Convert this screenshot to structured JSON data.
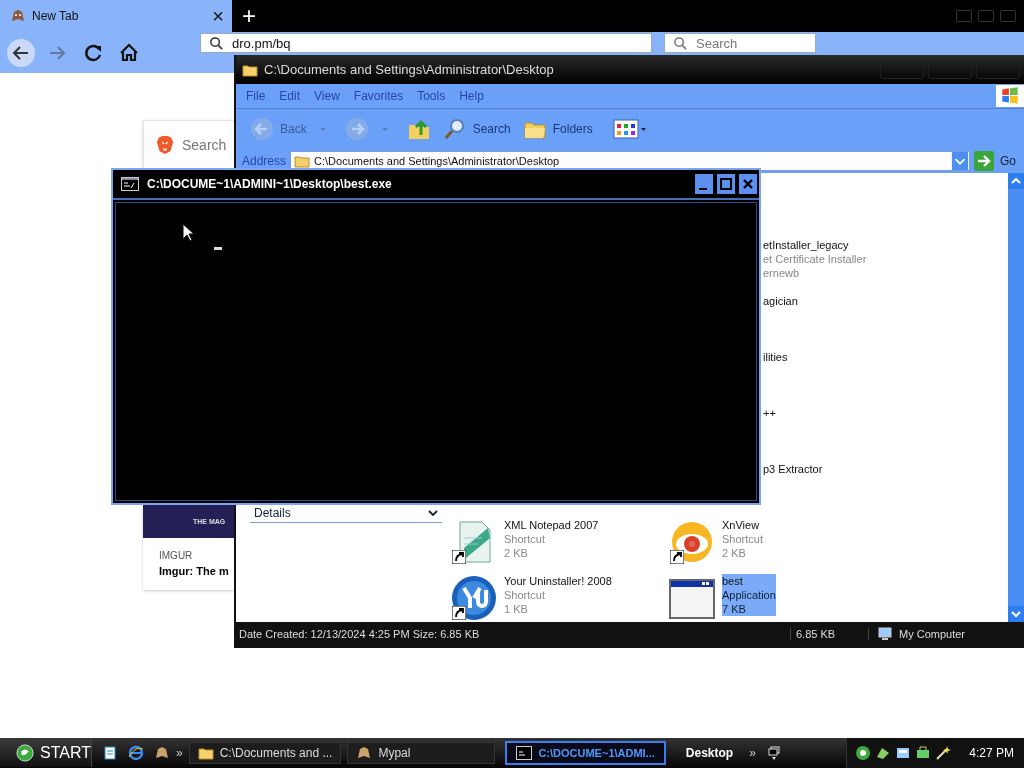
{
  "browser": {
    "tab": {
      "title": "New Tab",
      "close": "×",
      "selected": true
    },
    "new_tab": "+",
    "forward_disabled": true,
    "url": "dro.pm/bq",
    "search_placeholder": "Search",
    "page": {
      "search_card": {
        "placeholder": "Search"
      },
      "story": {
        "image_text": "THE MAG",
        "source": "IMGUR",
        "title": "Imgur: The m"
      }
    }
  },
  "explorer": {
    "title": "C:\\Documents and Settings\\Administrator\\Desktop",
    "menu": [
      "File",
      "Edit",
      "View",
      "Favorites",
      "Tools",
      "Help"
    ],
    "toolbar": [
      {
        "kind": "back",
        "label": "Back",
        "disabled": true
      },
      {
        "kind": "forward",
        "disabled": true
      },
      {
        "kind": "up",
        "disabled": false
      },
      {
        "kind": "search",
        "label": "Search",
        "disabled": false
      },
      {
        "kind": "folders",
        "label": "Folders",
        "disabled": false
      },
      {
        "kind": "views",
        "disabled": false
      }
    ],
    "address_label": "Address",
    "address": "C:\\Documents and Settings\\Administrator\\Desktop",
    "go": "Go",
    "details": "Details",
    "fragments": [
      {
        "lines": [
          "etInstaller_legacy",
          "et Certificate Installer",
          "ernewb"
        ]
      },
      {
        "lines": [
          "agician"
        ]
      },
      {
        "lines": [
          "ilities"
        ]
      },
      {
        "lines": [
          "++"
        ]
      },
      {
        "lines": [
          "p3 Extractor"
        ]
      }
    ],
    "files": [
      {
        "name": "XML Notepad 2007",
        "type": "Shortcut",
        "size": "2 KB",
        "kind": "xml",
        "shortcut": true,
        "selected": false
      },
      {
        "name": "XnView",
        "type": "Shortcut",
        "size": "2 KB",
        "kind": "eye",
        "shortcut": true,
        "selected": false
      },
      {
        "name": "Your Uninstaller! 2008",
        "type": "Shortcut",
        "size": "1 KB",
        "kind": "uninstaller",
        "shortcut": true,
        "selected": false
      },
      {
        "name": "best",
        "type": "Application",
        "size": "7 KB",
        "kind": "app",
        "shortcut": false,
        "selected": true
      }
    ],
    "status": {
      "info": "Date Created: 12/13/2024 4:25 PM Size: 6.85 KB",
      "size": "6.85 KB",
      "zone": "My Computer"
    }
  },
  "console": {
    "title": "C:\\DOCUME~1\\ADMINI~1\\Desktop\\best.exe"
  },
  "taskbar": {
    "start": "START",
    "quick_launch_more": "»",
    "tasks": [
      {
        "label": "C:\\Documents and ...",
        "kind": "folder",
        "selected": false
      },
      {
        "label": "Mypal",
        "kind": "mypal",
        "selected": false
      },
      {
        "label": "C:\\DOCUME~1\\ADMI...",
        "kind": "console",
        "selected": true
      }
    ],
    "desktop": "Desktop",
    "desktop_more": "»",
    "clock": "4:27 PM"
  }
}
